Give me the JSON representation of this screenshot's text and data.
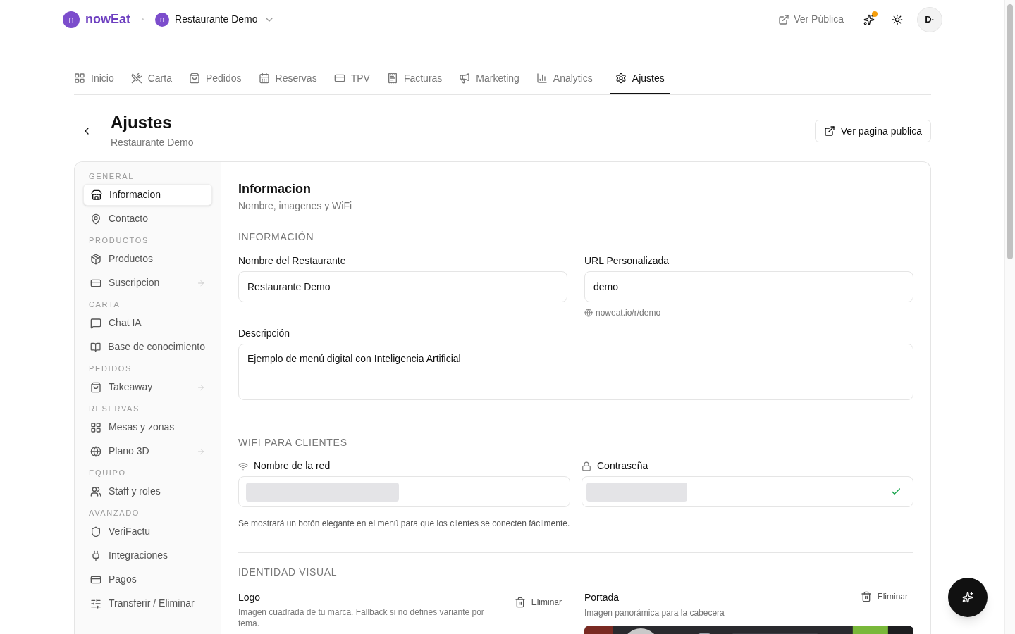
{
  "header": {
    "brand": "nowEat",
    "brand_mark": "n",
    "restaurant": {
      "mark": "n",
      "name": "Restaurante Demo"
    },
    "public_link": "Ver Pública",
    "notification": true,
    "avatar": "D·"
  },
  "tabs": [
    {
      "label": "Inicio",
      "selected": false
    },
    {
      "label": "Carta",
      "selected": false
    },
    {
      "label": "Pedidos",
      "selected": false
    },
    {
      "label": "Reservas",
      "selected": false
    },
    {
      "label": "TPV",
      "selected": false
    },
    {
      "label": "Facturas",
      "selected": false
    },
    {
      "label": "Marketing",
      "selected": false
    },
    {
      "label": "Analytics",
      "selected": false
    },
    {
      "label": "Ajustes",
      "selected": true
    }
  ],
  "page": {
    "title": "Ajustes",
    "subtitle": "Restaurante Demo",
    "action": "Ver pagina publica"
  },
  "sidebar": [
    {
      "heading": "GENERAL",
      "items": [
        {
          "label": "Informacion",
          "selected": true,
          "arrow": false
        },
        {
          "label": "Contacto",
          "selected": false,
          "arrow": false
        }
      ]
    },
    {
      "heading": "PRODUCTOS",
      "items": [
        {
          "label": "Productos",
          "selected": false,
          "arrow": false
        },
        {
          "label": "Suscripcion",
          "selected": false,
          "arrow": true
        }
      ]
    },
    {
      "heading": "CARTA",
      "items": [
        {
          "label": "Chat IA",
          "selected": false,
          "arrow": false
        },
        {
          "label": "Base de conocimiento",
          "selected": false,
          "arrow": false
        }
      ]
    },
    {
      "heading": "PEDIDOS",
      "items": [
        {
          "label": "Takeaway",
          "selected": false,
          "arrow": true
        }
      ]
    },
    {
      "heading": "RESERVAS",
      "items": [
        {
          "label": "Mesas y zonas",
          "selected": false,
          "arrow": false
        },
        {
          "label": "Plano 3D",
          "selected": false,
          "arrow": true
        }
      ]
    },
    {
      "heading": "EQUIPO",
      "items": [
        {
          "label": "Staff y roles",
          "selected": false,
          "arrow": false
        }
      ]
    },
    {
      "heading": "AVANZADO",
      "items": [
        {
          "label": "VeriFactu",
          "selected": false,
          "arrow": false
        },
        {
          "label": "Integraciones",
          "selected": false,
          "arrow": false
        },
        {
          "label": "Pagos",
          "selected": false,
          "arrow": false
        },
        {
          "label": "Transferir / Eliminar",
          "selected": false,
          "arrow": false
        }
      ]
    }
  ],
  "panel": {
    "title": "Informacion",
    "subtitle": "Nombre, imagenes y WiFi",
    "info": {
      "heading": "INFORMACIÓN",
      "name_label": "Nombre del Restaurante",
      "name_value": "Restaurante Demo",
      "url_label": "URL Personalizada",
      "url_value": "demo",
      "url_hint": "noweat.io/r/demo",
      "desc_label": "Descripción",
      "desc_value": "Ejemplo de menú digital con Inteligencia Artificial"
    },
    "wifi": {
      "heading": "WIFI PARA CLIENTES",
      "network_label": "Nombre de la red",
      "password_label": "Contraseña",
      "password_valid": true,
      "hint": "Se mostrará un botón elegante en el menú para que los clientes se conecten fácilmente."
    },
    "identity": {
      "heading": "IDENTIDAD VISUAL",
      "logo": {
        "title": "Logo",
        "description": "Imagen cuadrada de tu marca. Fallback si no defines variante por tema.",
        "remove": "Eliminar"
      },
      "cover": {
        "title": "Portada",
        "description": "Imagen panorámica para la cabecera",
        "remove": "Eliminar"
      }
    }
  }
}
